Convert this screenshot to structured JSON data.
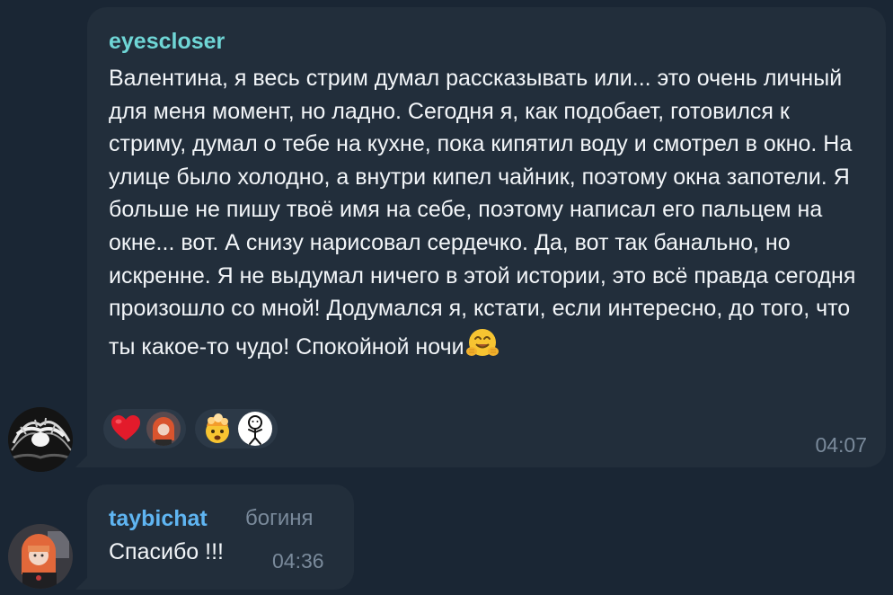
{
  "messages": [
    {
      "sender": "eyescloser",
      "text": "Валентина, я весь стрим думал рассказывать или... это очень личный для меня момент, но ладно. Сегодня я, как подобает, готовился к стриму, думал о тебе на кухне, пока кипятил воду и смотрел в окно. На улице было холодно, а внутри кипел чайник, поэтому окна запотели. Я больше не пишу твоё имя на себе, поэтому написал его пальцем на окне... вот. А снизу нарисовал сердечко. Да, вот так банально, но искренне. Я не выдумал ничего в этой истории, это всё правда сегодня произошло со мной! Додумался я, кстати, если интересно, до того, что ты какое-то чудо! Спокойной ночи",
      "trailing_emoji": "hugging-face-emoji",
      "time": "04:07",
      "reactions": [
        {
          "emoji": "red-heart",
          "reactor": "avatar-girl-red-hair"
        },
        {
          "emoji": "exploding-head",
          "reactor": "avatar-stick-figure"
        }
      ],
      "colors": {
        "sender": "#6fd6d6"
      }
    },
    {
      "sender": "taybichat",
      "admin_title": "богиня",
      "text": "Спасибо !!!",
      "time": "04:36",
      "colors": {
        "sender": "#5fb5f2"
      }
    }
  ],
  "theme": {
    "background": "#1a2634",
    "bubble": "#222e3b",
    "text": "#f2f5f8",
    "meta": "#7a8a9b"
  }
}
